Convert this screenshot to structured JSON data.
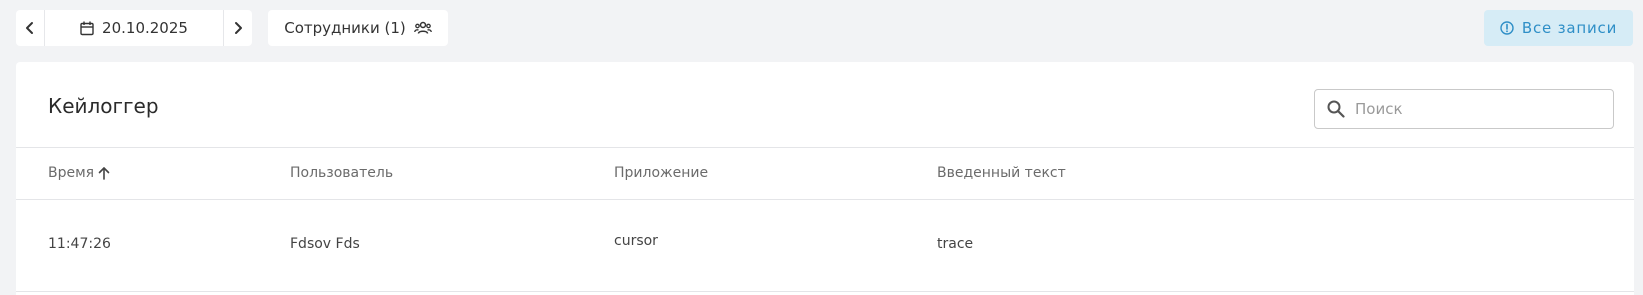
{
  "toolbar": {
    "date": "20.10.2025",
    "employees_label": "Сотрудники (1)",
    "all_records_label": "Все записи"
  },
  "card": {
    "title": "Кейлоггер",
    "search_placeholder": "Поиск"
  },
  "table": {
    "columns": [
      "Время",
      "Пользователь",
      "Приложение",
      "Введенный текст"
    ],
    "sort": "ascending",
    "rows": [
      {
        "time": "11:47:26",
        "user": "Fdsov Fds",
        "app": "cursor",
        "text": "trace"
      }
    ]
  },
  "colors": {
    "background": "#f2f3f5",
    "accent": "#2f8fc7",
    "accent_bg": "#d6ecf6"
  }
}
